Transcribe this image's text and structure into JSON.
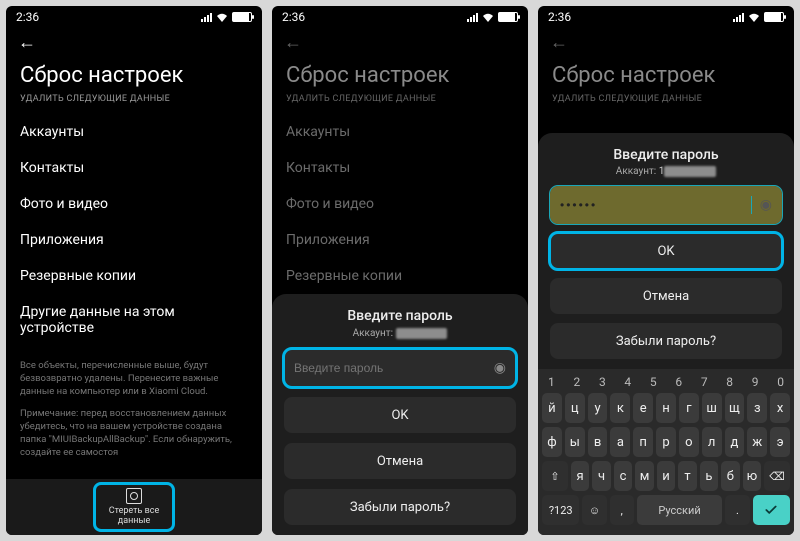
{
  "status": {
    "time": "2:36"
  },
  "screen1": {
    "title": "Сброс настроек",
    "subhead": "УДАЛИТЬ СЛЕДУЮЩИЕ ДАННЫЕ",
    "items": [
      "Аккаунты",
      "Контакты",
      "Фото и видео",
      "Приложения",
      "Резервные копии",
      "Другие данные на этом устройстве"
    ],
    "footnote1": "Все объекты, перечисленные выше, будут безвозвратно удалены. Перенесите важные данные на компьютер или в Xiaomi Cloud.",
    "footnote2": "Примечание: перед восстановлением данных убедитесь, что на вашем устройстве создана папка \"MIUIBackupAllBackup\". Если обнаружить, создайте ее самостоя",
    "erase_label1": "Стереть все",
    "erase_label2": "данные"
  },
  "dialog": {
    "title": "Введите пароль",
    "account_label": "Аккаунт:",
    "placeholder": "Введите пароль",
    "filled_value": "••••••",
    "ok": "OK",
    "cancel": "Отмена",
    "forgot": "Забыли пароль?"
  },
  "keyboard": {
    "nums": [
      "1",
      "2",
      "3",
      "4",
      "5",
      "6",
      "7",
      "8",
      "9",
      "0"
    ],
    "row1": [
      "й",
      "ц",
      "у",
      "к",
      "е",
      "н",
      "г",
      "ш",
      "щ",
      "з",
      "х"
    ],
    "row2": [
      "ф",
      "ы",
      "в",
      "а",
      "п",
      "р",
      "о",
      "л",
      "д",
      "ж",
      "э"
    ],
    "row3": [
      "я",
      "ч",
      "с",
      "м",
      "и",
      "т",
      "ь",
      "б",
      "ю"
    ],
    "shift": "⇧",
    "backspace": "⌫",
    "sym": "?123",
    "lang": "Русский",
    "emoji": "☺",
    "comma": ","
  }
}
